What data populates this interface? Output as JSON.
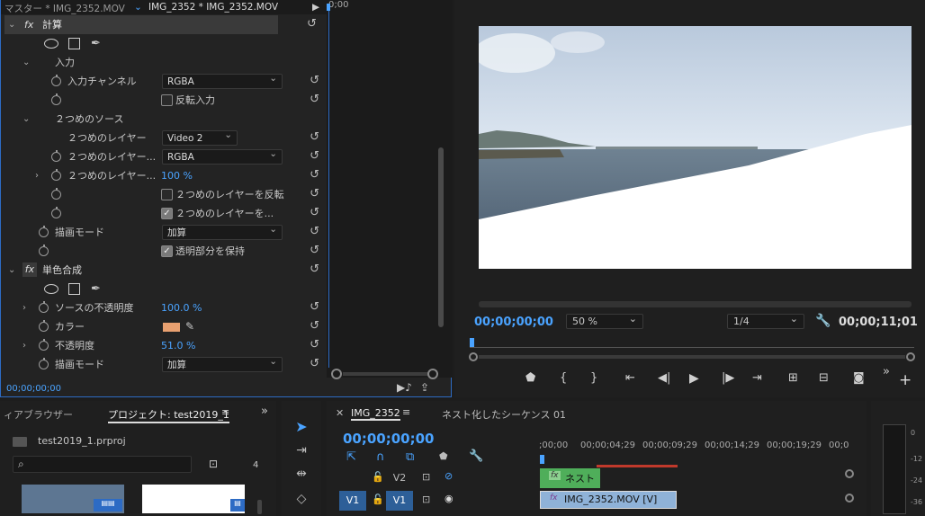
{
  "effect_controls": {
    "tab_master": "マスター * IMG_2352.MOV",
    "tab_clip": "IMG_2352 * IMG_2352.MOV",
    "ruler_time": "0;00",
    "timecode": "00;00;00;00",
    "calc": {
      "title": "計算",
      "input_section": "入力",
      "input_channel_label": "入力チャンネル",
      "input_channel_value": "RGBA",
      "invert_input_label": "反転入力",
      "second_source_section": "２つめのソース",
      "second_layer_label": "２つめのレイヤー",
      "second_layer_value": "Video 2",
      "second_layer_channel_label": "２つめのレイヤー...",
      "second_layer_channel_value": "RGBA",
      "second_layer_opacity_label": "２つめのレイヤー...",
      "second_layer_opacity_value": "100 %",
      "second_layer_invert_label": "２つめのレイヤーを反転",
      "second_layer_stretch_label": "２つめのレイヤーを...",
      "blend_mode_label": "描画モード",
      "blend_mode_value": "加算",
      "preserve_transparency_label": "透明部分を保持"
    },
    "solid_composite": {
      "title": "単色合成",
      "source_opacity_label": "ソースの不透明度",
      "source_opacity_value": "100.0 %",
      "color_label": "カラー",
      "color_hex": "#e8a070",
      "opacity_label": "不透明度",
      "opacity_value": "51.0 %",
      "blend_mode_label": "描画モード",
      "blend_mode_value": "加算"
    }
  },
  "program_monitor": {
    "timecode_current": "00;00;00;00",
    "zoom": "50 %",
    "resolution": "1/4",
    "timecode_duration": "00;00;11;01"
  },
  "project_panel": {
    "tab_media_browser": "ィアブラウザー",
    "tab_project": "プロジェクト: test2019_1",
    "project_file": "test2019_1.prproj",
    "item_count": "4"
  },
  "timeline": {
    "tab_sequence": "IMG_2352",
    "nested_label": "ネスト化したシーケンス 01",
    "timecode": "00;00;00;00",
    "ruler_ticks": [
      ";00;00",
      "00;00;04;29",
      "00;00;09;29",
      "00;00;14;29",
      "00;00;19;29",
      "00;0"
    ],
    "track_v2": "V2",
    "track_v1": "V1",
    "source_v1": "V1",
    "clip_nest": "ネスト",
    "clip_v1": "IMG_2352.MOV [V]"
  },
  "audio_meter": {
    "ticks": [
      "0",
      "-12",
      "-24",
      "-36"
    ]
  },
  "colors": {
    "accent": "#4aa3ff",
    "clip_green": "#4fae5a",
    "clip_blue": "#8fb2d8",
    "panel_focus": "#2d6bc4"
  }
}
